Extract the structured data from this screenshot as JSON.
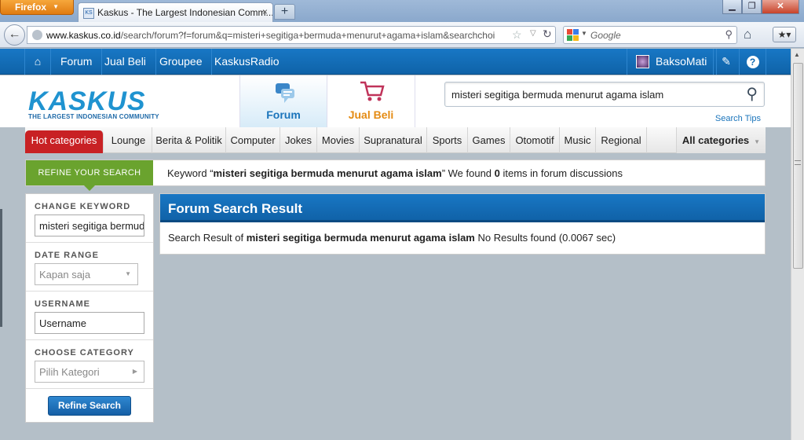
{
  "browser": {
    "menu_label": "Firefox",
    "tab_title": "Kaskus - The Largest Indonesian Comm...",
    "tab_favicon": "KS",
    "url_domain": "www.kaskus.co.id",
    "url_path": "/search/forum?f=forum&q=misteri+segitiga+bermuda+menurut+agama+islam&searchchoi",
    "search_placeholder": "Google"
  },
  "site_nav": {
    "items": [
      "Forum",
      "Jual Beli",
      "Groupee",
      "KaskusRadio"
    ],
    "username": "BaksoMati"
  },
  "header": {
    "logo_word": "KASKUS",
    "logo_tagline": "THE LARGEST INDONESIAN COMMUNITY",
    "tab_forum": "Forum",
    "tab_jualbeli": "Jual Beli",
    "search_value": "misteri segitiga bermuda menurut agama islam",
    "search_tips": "Search Tips"
  },
  "categories": {
    "hot": "Hot categories",
    "items": [
      "Lounge",
      "Berita & Politik",
      "Computer",
      "Jokes",
      "Movies",
      "Supranatural",
      "Sports",
      "Games",
      "Otomotif",
      "Music",
      "Regional"
    ],
    "all": "All categories"
  },
  "keyword_bar": {
    "refine_label": "REFINE YOUR SEARCH",
    "prefix": "Keyword “",
    "keyword": "misteri segitiga bermuda menurut agama islam",
    "middle": "” We found ",
    "count": "0",
    "suffix": " items in forum discussions"
  },
  "sidebar": {
    "change_keyword_label": "CHANGE KEYWORD",
    "keyword_value": "misteri segitiga bermuda menurut agama islam",
    "date_range_label": "DATE RANGE",
    "date_range_value": "Kapan saja",
    "username_label": "USERNAME",
    "username_value": "Username",
    "category_label": "CHOOSE CATEGORY",
    "category_value": "Pilih Kategori",
    "refine_button": "Refine Search"
  },
  "results": {
    "title": "Forum Search Result",
    "prefix": "Search Result of ",
    "keyword": "misteri segitiga bermuda menurut agama islam",
    "suffix": " No Results found (0.0067 sec)"
  },
  "colors": {
    "kaskus_blue": "#1069b1",
    "hot_red": "#c82124",
    "refine_green": "#6aa32e",
    "jualbeli_orange": "#e48b13"
  }
}
